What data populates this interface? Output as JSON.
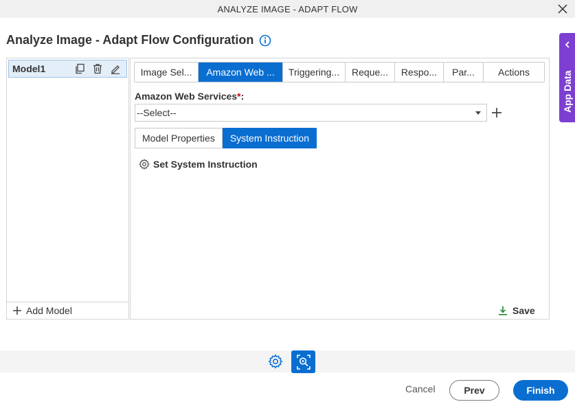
{
  "window": {
    "title": "ANALYZE IMAGE - ADAPT FLOW",
    "close_icon": "close-icon"
  },
  "page": {
    "heading": "Analyze Image - Adapt Flow Configuration",
    "info_icon": "info-icon"
  },
  "app_data": {
    "label": "App Data",
    "icon": "chevron-left-icon",
    "color": "#7c3fd1"
  },
  "models": {
    "items": [
      {
        "name": "Model1",
        "icons": [
          "copy-icon",
          "delete-icon",
          "edit-icon"
        ]
      }
    ],
    "add_label": "Add Model"
  },
  "tabs": [
    {
      "label": "Image Sel...",
      "active": false
    },
    {
      "label": "Amazon Web ...",
      "active": true
    },
    {
      "label": "Triggering...",
      "active": false
    },
    {
      "label": "Reque...",
      "active": false
    },
    {
      "label": "Respo...",
      "active": false
    },
    {
      "label": "Par...",
      "active": false
    },
    {
      "label": "Actions",
      "active": false
    }
  ],
  "aws_field": {
    "label": "Amazon Web Services",
    "required_mark": "*",
    "colon": ":",
    "value": "--Select--"
  },
  "subtabs": [
    {
      "label": "Model Properties",
      "active": false
    },
    {
      "label": "System Instruction",
      "active": true
    }
  ],
  "system_instruction": {
    "action_label": "Set System Instruction",
    "icon": "gear-icon"
  },
  "save": {
    "label": "Save",
    "icon": "download-icon"
  },
  "footer": {
    "cancel_label": "Cancel",
    "prev_label": "Prev",
    "finish_label": "Finish"
  },
  "colors": {
    "accent": "#0a6ed1",
    "required": "#d0021b",
    "app_data": "#7c3fd1"
  }
}
